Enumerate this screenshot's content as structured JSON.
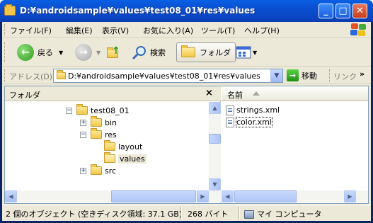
{
  "window": {
    "title": "D:¥androidsample¥values¥test08_01¥res¥values",
    "min": "_",
    "max": "□",
    "close": "✕"
  },
  "menu": {
    "items": [
      "ファイル(F)",
      "編集(E)",
      "表示(V)",
      "お気に入り(A)",
      "ツール(T)",
      "ヘルプ(H)"
    ]
  },
  "toolbar": {
    "back_label": "戻る",
    "search_label": "検索",
    "folders_label": "フォルダ"
  },
  "address": {
    "label": "アドレス(D)",
    "value": "D:¥androidsample¥values¥test08_01¥res¥values",
    "go_label": "移動",
    "links_label": "リンク"
  },
  "folder_pane": {
    "title": "フォルダ",
    "close": "×",
    "tree": {
      "test08_01": "test08_01",
      "bin": "bin",
      "res": "res",
      "layout": "layout",
      "values": "values",
      "src": "src"
    }
  },
  "file_pane": {
    "column_name": "名前",
    "files": [
      "strings.xml",
      "color.xml"
    ]
  },
  "status": {
    "objects": "2 個のオブジェクト (空きディスク領域: 37.1 GB)",
    "size": "268 バイト",
    "location": "マイ コンピュータ"
  },
  "colors": {
    "titlebar": "#0a4fd0",
    "chrome": "#ece9d8",
    "go_green": "#2f9a1c"
  }
}
